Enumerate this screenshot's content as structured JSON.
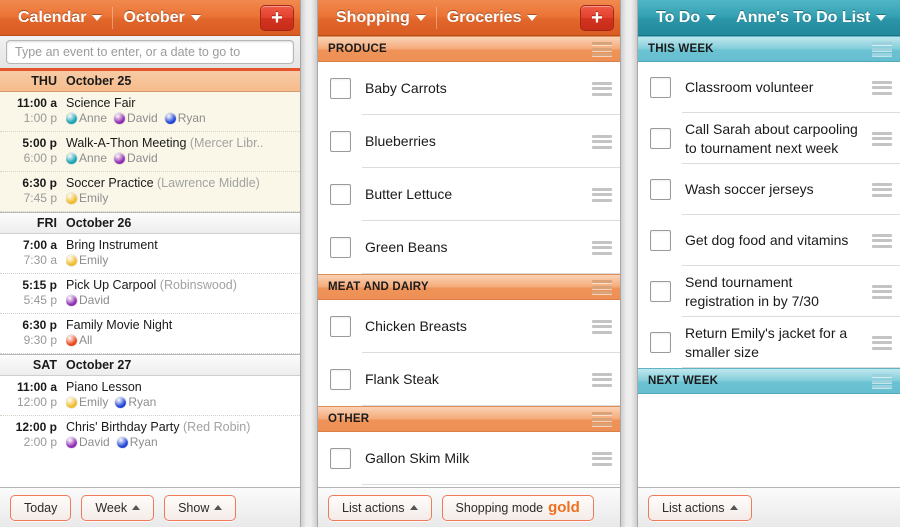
{
  "calendar": {
    "topbar": {
      "app_label": "Calendar",
      "scope_label": "October",
      "add_label": "+"
    },
    "search": {
      "placeholder": "Type an event to enter, or a date to go to",
      "value": ""
    },
    "days": [
      {
        "dow": "THU",
        "date": "October 25",
        "today": true,
        "events": [
          {
            "start": "11:00 a",
            "end": "1:00 p",
            "title": "Science Fair",
            "location": "",
            "people": [
              {
                "name": "Anne",
                "color": "#1aa3b8"
              },
              {
                "name": "David",
                "color": "#8f2bb5"
              },
              {
                "name": "Ryan",
                "color": "#1f44d8"
              }
            ]
          },
          {
            "start": "5:00 p",
            "end": "6:00 p",
            "title": "Walk-A-Thon Meeting",
            "location": "(Mercer Libr..",
            "people": [
              {
                "name": "Anne",
                "color": "#1aa3b8"
              },
              {
                "name": "David",
                "color": "#8f2bb5"
              }
            ]
          },
          {
            "start": "6:30 p",
            "end": "7:45 p",
            "title": "Soccer Practice",
            "location": "(Lawrence Middle)",
            "people": [
              {
                "name": "Emily",
                "color": "#f2bd2b"
              }
            ]
          }
        ]
      },
      {
        "dow": "FRI",
        "date": "October 26",
        "today": false,
        "events": [
          {
            "start": "7:00 a",
            "end": "7:30 a",
            "title": "Bring Instrument",
            "location": "",
            "people": [
              {
                "name": "Emily",
                "color": "#f2bd2b"
              }
            ]
          },
          {
            "start": "5:15 p",
            "end": "5:45 p",
            "title": "Pick Up Carpool",
            "location": "(Robinswood)",
            "people": [
              {
                "name": "David",
                "color": "#8f2bb5"
              }
            ]
          },
          {
            "start": "6:30 p",
            "end": "9:30 p",
            "title": "Family Movie Night",
            "location": "",
            "people": [
              {
                "name": "All",
                "color": "#ee4417"
              }
            ]
          }
        ]
      },
      {
        "dow": "SAT",
        "date": "October 27",
        "today": false,
        "events": [
          {
            "start": "11:00 a",
            "end": "12:00 p",
            "title": "Piano Lesson",
            "location": "",
            "people": [
              {
                "name": "Emily",
                "color": "#f2bd2b"
              },
              {
                "name": "Ryan",
                "color": "#1f44d8"
              }
            ]
          },
          {
            "start": "12:00 p",
            "end": "2:00 p",
            "title": "Chris' Birthday Party",
            "location": "(Red Robin)",
            "people": [
              {
                "name": "David",
                "color": "#8f2bb5"
              },
              {
                "name": "Ryan",
                "color": "#1f44d8"
              }
            ]
          }
        ]
      }
    ],
    "bottom": {
      "today_label": "Today",
      "week_label": "Week",
      "show_label": "Show"
    }
  },
  "shopping": {
    "topbar": {
      "app_label": "Shopping",
      "scope_label": "Groceries",
      "add_label": "+"
    },
    "groups": [
      {
        "title": "PRODUCE",
        "items": [
          {
            "label": "Baby Carrots",
            "checked": false
          },
          {
            "label": "Blueberries",
            "checked": false
          },
          {
            "label": "Butter Lettuce",
            "checked": false
          },
          {
            "label": "Green Beans",
            "checked": false
          }
        ]
      },
      {
        "title": "MEAT AND DAIRY",
        "items": [
          {
            "label": "Chicken Breasts",
            "checked": false
          },
          {
            "label": "Flank Steak",
            "checked": false
          }
        ]
      },
      {
        "title": "OTHER",
        "items": [
          {
            "label": "Gallon Skim Milk",
            "checked": false
          }
        ]
      }
    ],
    "bottom": {
      "list_actions_label": "List actions",
      "shopping_mode_label": "Shopping mode",
      "mode_value": "gold"
    }
  },
  "todo": {
    "topbar": {
      "app_label": "To Do",
      "scope_label": "Anne's To Do List",
      "add_label": ""
    },
    "groups": [
      {
        "title": "THIS WEEK",
        "items": [
          {
            "label": "Classroom volunteer",
            "checked": false
          },
          {
            "label": "Call Sarah about carpooling to tournament next week",
            "checked": false
          },
          {
            "label": "Wash soccer jerseys",
            "checked": false
          },
          {
            "label": "Get dog food and vitamins",
            "checked": false
          },
          {
            "label": "Send tournament registration in by 7/30",
            "checked": false
          },
          {
            "label": "Return Emily's jacket for a smaller size",
            "checked": false
          }
        ]
      },
      {
        "title": "NEXT WEEK",
        "items": []
      }
    ],
    "bottom": {
      "list_actions_label": "List actions"
    }
  },
  "colors": {
    "calendar_accent": "#e4552b",
    "shopping_accent": "#ee9056",
    "todo_accent": "#35a2b4",
    "button_border": "#ef7b5a",
    "gold_text": "#ef7021"
  }
}
